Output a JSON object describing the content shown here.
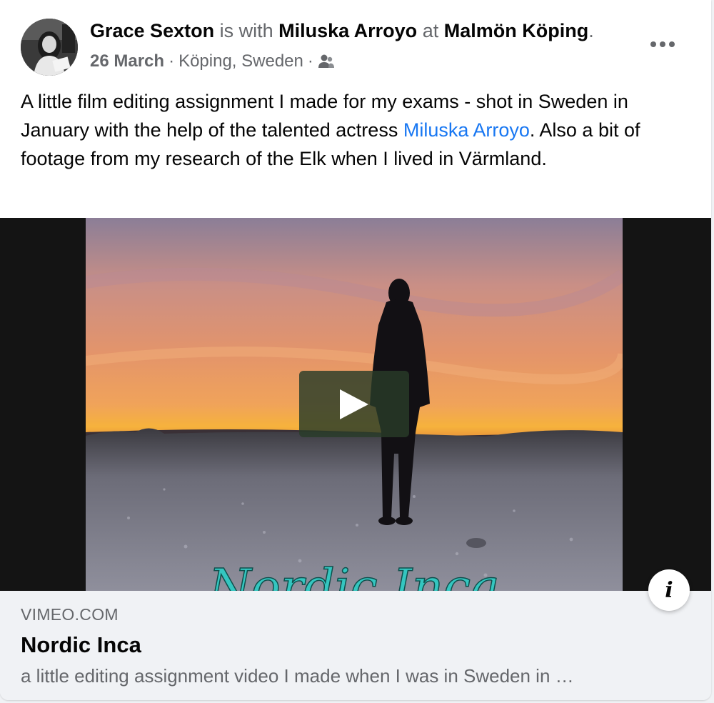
{
  "post": {
    "author": "Grace Sexton",
    "is_with": "is with",
    "tagged": "Miluska Arroyo",
    "at": "at",
    "place": "Malmön Köping",
    "period": ".",
    "date": "26 March",
    "separator": "·",
    "location": "Köping, Sweden",
    "audience_icon": "friends-icon",
    "more_icon": "more-options-icon",
    "text_before": "A little film editing assignment I made for my exams - shot in Sweden in January with the help of the talented actress ",
    "text_mention": "Miluska Arroyo",
    "text_after": ".   Also a bit of footage from my research of the Elk when I lived in Värmland."
  },
  "media": {
    "overlay_title": "Nordic Inca",
    "play_icon": "play-icon",
    "info_icon": "info-icon",
    "info_label": "i"
  },
  "link_preview": {
    "domain": "VIMEO.COM",
    "title": "Nordic Inca",
    "description": "a little editing assignment video I made when I was in Sweden in …"
  },
  "colors": {
    "link": "#1877f2",
    "text": "#050505",
    "secondary": "#65676b",
    "preview_bg": "#f0f2f5"
  }
}
